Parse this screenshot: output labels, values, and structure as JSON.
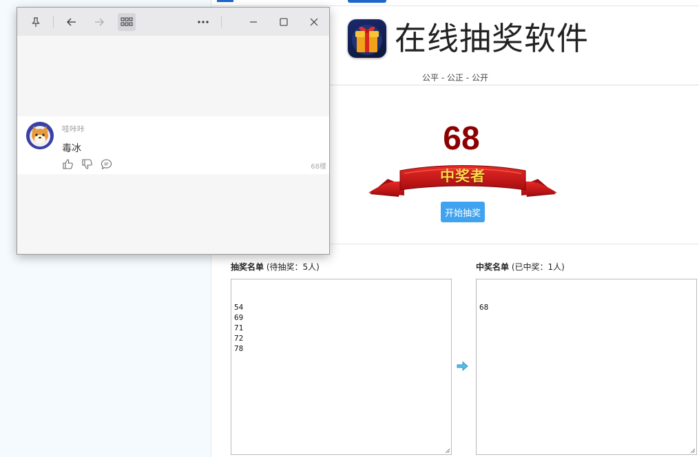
{
  "page": {
    "title": "在线抽奖软件",
    "subtitle": "公平 - 公正 - 公开",
    "winner_number": "68",
    "ribbon_text": "中奖者",
    "start_button": "开始抽奖",
    "pending_list": {
      "label": "抽奖名单",
      "count_text": "(待抽奖：5人)",
      "items": [
        "54",
        "69",
        "71",
        "72",
        "78"
      ]
    },
    "winner_list": {
      "label": "中奖名单",
      "count_text": "(已中奖：1人)",
      "items": [
        "68"
      ]
    }
  },
  "float_window": {
    "comment": {
      "username": "哇咔咔",
      "text": "毒冰",
      "floor": "68楼"
    }
  },
  "icons": {
    "pin": "pin-icon",
    "back": "arrow-left-icon",
    "forward": "arrow-right-icon",
    "apps": "grid-icon",
    "more": "more-icon",
    "minimize": "minimize-icon",
    "maximize": "maximize-icon",
    "close": "close-icon",
    "like": "thumbs-up-icon",
    "dislike": "thumbs-down-icon",
    "reply": "reply-icon",
    "transfer": "arrow-right-icon"
  },
  "colors": {
    "winner_number": "#8b0000",
    "button": "#40a3f0",
    "ribbon": "#c8141a",
    "ribbon_text": "#ffd94a"
  }
}
